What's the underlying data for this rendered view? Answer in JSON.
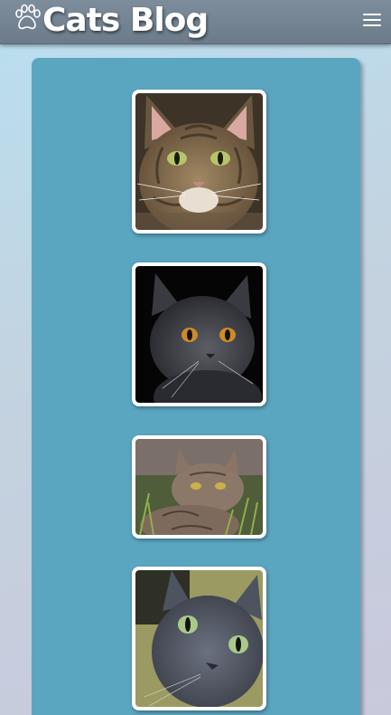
{
  "header": {
    "title": "Cats Blog",
    "logo_icon": "paw-print-icon",
    "menu_icon": "hamburger-menu-icon"
  },
  "gallery": {
    "images": [
      {
        "name": "tabby-cat-photo",
        "colors": {
          "fur": "#8a7355",
          "eyes": "#b8c46a"
        }
      },
      {
        "name": "gray-cat-dark-background-photo",
        "colors": {
          "fur": "#4a4c52",
          "eyes": "#d08a25"
        }
      },
      {
        "name": "tabby-cat-in-grass-photo",
        "colors": {
          "fur": "#8c7868",
          "eyes": "#c9b04a"
        }
      },
      {
        "name": "gray-cat-green-eyes-photo",
        "colors": {
          "fur": "#5a6070",
          "eyes": "#a9c98a"
        }
      }
    ]
  },
  "colors": {
    "header": "#74838f",
    "panel": "#5aa6c1",
    "frame": "#ffffff"
  }
}
